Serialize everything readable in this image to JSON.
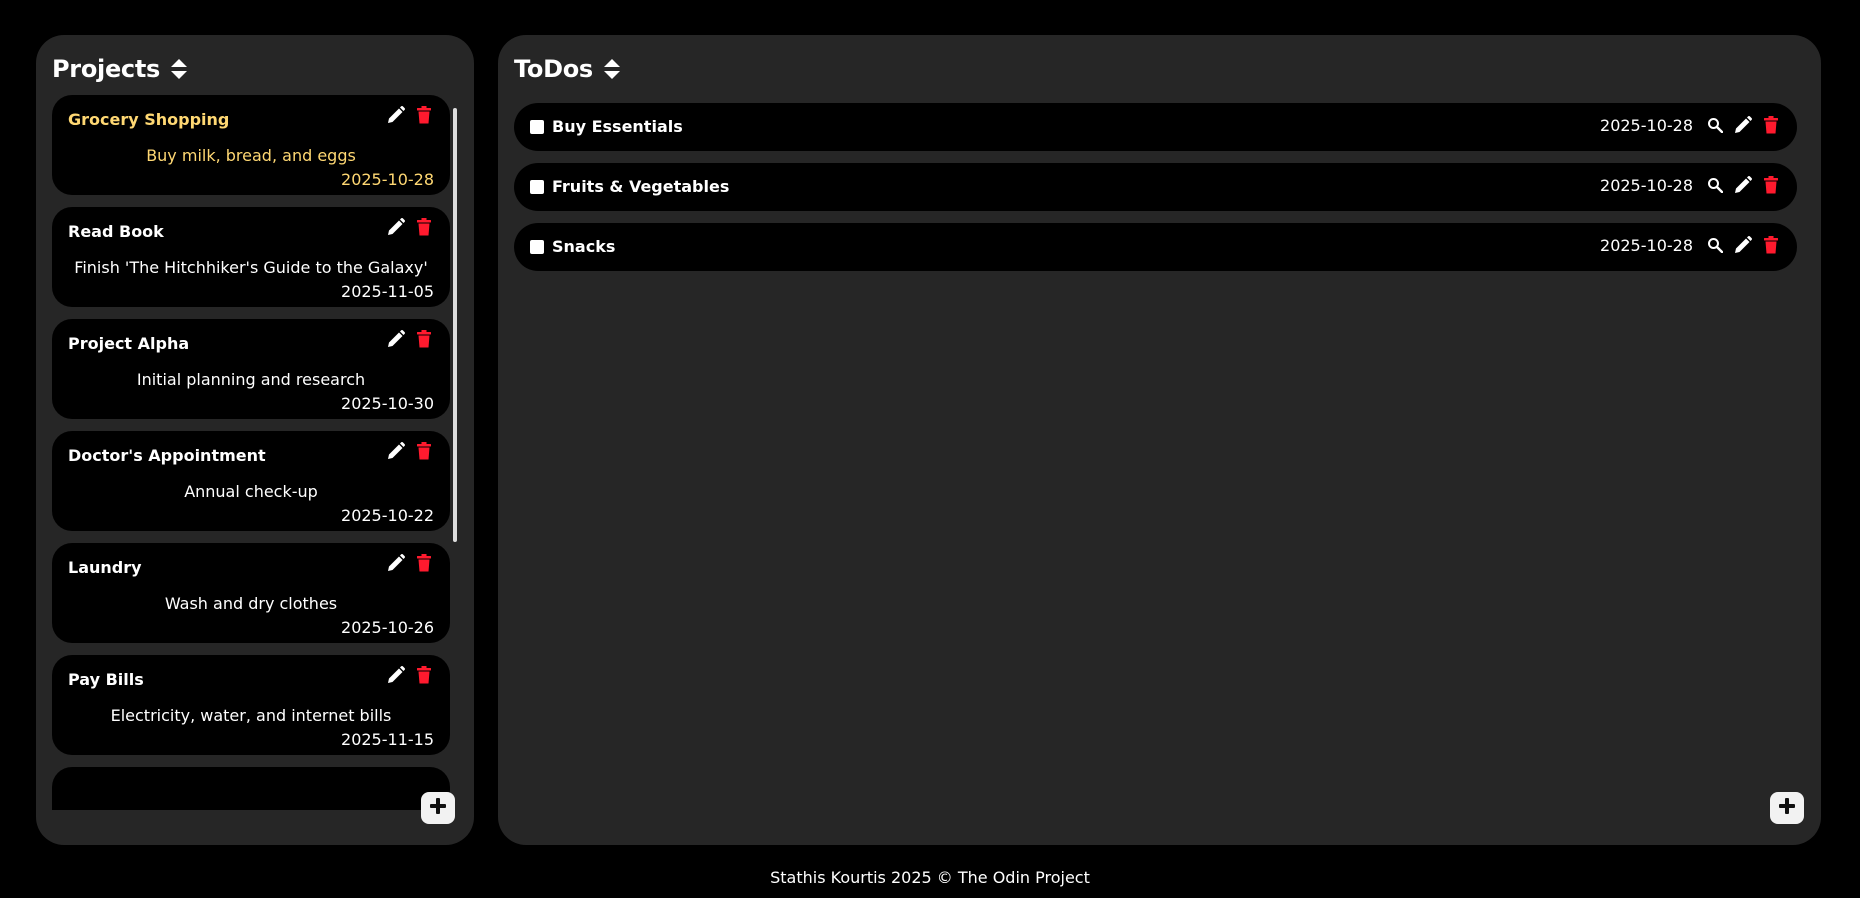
{
  "projects": {
    "title": "Projects",
    "sort_icon": "sort-up-down-icon",
    "add_icon": "plus-icon",
    "items": [
      {
        "name": "Grocery Shopping",
        "description": "Buy milk, bread, and eggs",
        "date": "2025-10-28",
        "selected": true
      },
      {
        "name": "Read Book",
        "description": "Finish 'The Hitchhiker's Guide to the Galaxy'",
        "date": "2025-11-05",
        "selected": false
      },
      {
        "name": "Project Alpha",
        "description": "Initial planning and research",
        "date": "2025-10-30",
        "selected": false
      },
      {
        "name": "Doctor's Appointment",
        "description": "Annual check-up",
        "date": "2025-10-22",
        "selected": false
      },
      {
        "name": "Laundry",
        "description": "Wash and dry clothes",
        "date": "2025-10-26",
        "selected": false
      },
      {
        "name": "Pay Bills",
        "description": "Electricity, water, and internet bills",
        "date": "2025-11-15",
        "selected": false
      }
    ]
  },
  "todos": {
    "title": "ToDos",
    "sort_icon": "sort-up-down-icon",
    "add_icon": "plus-icon",
    "items": [
      {
        "title": "Buy Essentials",
        "date": "2025-10-28",
        "checked": false
      },
      {
        "title": "Fruits & Vegetables",
        "date": "2025-10-28",
        "checked": false
      },
      {
        "title": "Snacks",
        "date": "2025-10-28",
        "checked": false
      }
    ]
  },
  "icons": {
    "edit": "pencil-icon",
    "delete": "trash-icon",
    "view": "magnifier-icon"
  },
  "colors": {
    "background": "#000000",
    "panel": "#262626",
    "card": "#000000",
    "selected_text": "#ffd873",
    "delete_red": "#ff1a2e"
  },
  "footer": {
    "text": "Stathis Kourtis 2025 © The Odin Project"
  }
}
